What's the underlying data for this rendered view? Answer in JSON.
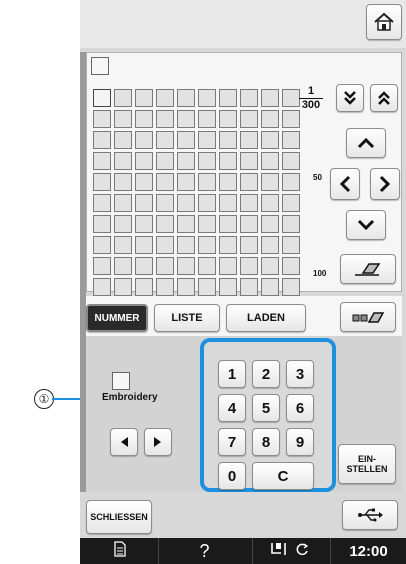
{
  "callout": {
    "marker": "①"
  },
  "header": {
    "home_icon": "home-icon"
  },
  "grid": {
    "page_current": "1",
    "page_total": "300",
    "row_marker_mid": "50",
    "row_marker_end": "100"
  },
  "tabs": {
    "nummer": "NUMMER",
    "liste": "LISTE",
    "laden": "LADEN"
  },
  "pattern": {
    "label": "Embroidery"
  },
  "keypad": {
    "k1": "1",
    "k2": "2",
    "k3": "3",
    "k4": "4",
    "k5": "5",
    "k6": "6",
    "k7": "7",
    "k8": "8",
    "k9": "9",
    "k0": "0",
    "clear": "C"
  },
  "actions": {
    "einstellen_line1": "EIN-",
    "einstellen_line2": "STELLEN",
    "schliessen": "SCHLIESSEN"
  },
  "statusbar": {
    "help": "?",
    "time": "12:00"
  },
  "colors": {
    "accent_blue": "#1e90e0",
    "status_bg": "#1a1a1a",
    "screen_bg": "#d8d8d8"
  }
}
